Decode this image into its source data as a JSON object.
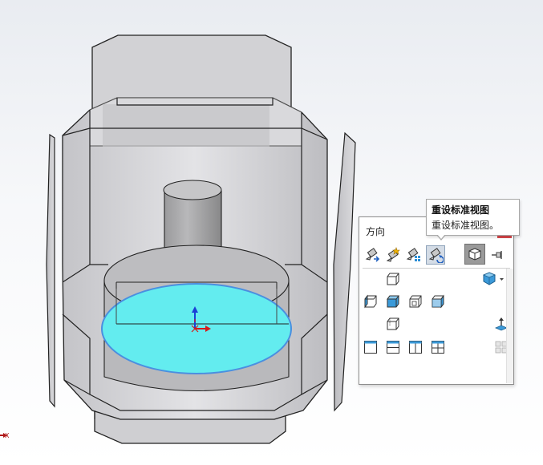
{
  "viewport": {
    "triad_axis_label": "X"
  },
  "orientation_panel": {
    "title": "方向",
    "tools": [
      {
        "name": "new-view",
        "icon": "camera-arrow-icon"
      },
      {
        "name": "update-view",
        "icon": "camera-star-icon"
      },
      {
        "name": "view-selector",
        "icon": "camera-grid-icon"
      },
      {
        "name": "reset-standard-views",
        "icon": "camera-reset-icon"
      }
    ],
    "views": [
      {
        "name": "front-view",
        "icon": "cube-front-icon"
      },
      {
        "name": "left-view",
        "icon": "cube-left-icon"
      },
      {
        "name": "top-view",
        "icon": "cube-top-icon"
      },
      {
        "name": "right-view",
        "icon": "cube-right-icon"
      },
      {
        "name": "bottom-view",
        "icon": "cube-bottom-icon"
      },
      {
        "name": "back-view",
        "icon": "cube-back-icon"
      },
      {
        "name": "single-view",
        "icon": "single-viewport-icon"
      },
      {
        "name": "two-view-horizontal",
        "icon": "two-viewport-horizontal-icon"
      },
      {
        "name": "two-view-vertical",
        "icon": "two-viewport-vertical-icon"
      },
      {
        "name": "four-view",
        "icon": "four-viewport-icon"
      }
    ],
    "accent_color": "#4aa3df"
  },
  "tooltip": {
    "title": "重设标准视图",
    "description": "重设标准视图。"
  },
  "colors": {
    "sketch_fill": "#63ecef",
    "sketch_outline": "#4a8fe0",
    "body_gray": "#c9c9cc"
  }
}
